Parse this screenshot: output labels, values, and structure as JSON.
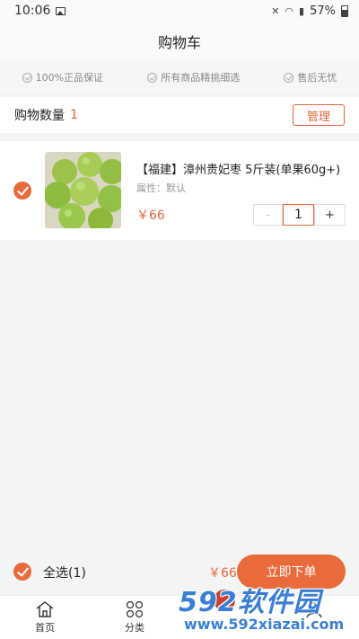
{
  "status_bar": {
    "time": "10:06",
    "battery": "57%"
  },
  "header": {
    "title": "购物车"
  },
  "guarantees": [
    {
      "label": "100%正品保证"
    },
    {
      "label": "所有商品精挑细选"
    },
    {
      "label": "售后无忧"
    }
  ],
  "cart_summary": {
    "label": "购物数量",
    "count": "1",
    "manage_label": "管理"
  },
  "items": [
    {
      "name": "【福建】漳州贵妃枣 5斤装(单果60g+)",
      "attribute": "属性：默认",
      "price": "￥66",
      "quantity": "1",
      "minus_label": "-",
      "plus_label": "+",
      "checked": true
    }
  ],
  "checkout": {
    "select_all_label": "全选(1)",
    "total": "￥66",
    "submit_label": "立即下单"
  },
  "tab_bar": [
    {
      "label": "首页",
      "icon": "home-icon"
    },
    {
      "label": "分类",
      "icon": "category-icon"
    },
    {
      "label": "",
      "icon": "cart-icon"
    },
    {
      "label": "",
      "icon": "user-icon"
    }
  ],
  "watermark": {
    "brand": "592软件园",
    "url": "www.592xiazai.com"
  },
  "colors": {
    "accent": "#e96a3b",
    "background": "#f3f3f3"
  }
}
